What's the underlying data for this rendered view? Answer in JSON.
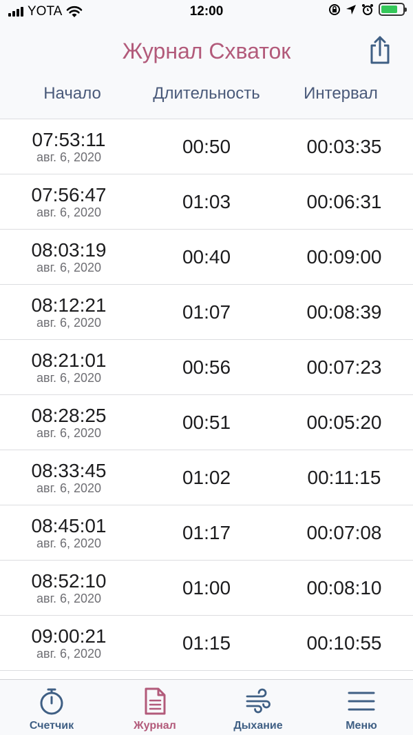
{
  "status_bar": {
    "carrier": "YOTA",
    "time": "12:00"
  },
  "header": {
    "title": "Журнал Схваток",
    "columns": [
      "Начало",
      "Длительность",
      "Интервал"
    ]
  },
  "rows": [
    {
      "start": "07:53:11",
      "date": "авг. 6, 2020",
      "duration": "00:50",
      "interval": "00:03:35"
    },
    {
      "start": "07:56:47",
      "date": "авг. 6, 2020",
      "duration": "01:03",
      "interval": "00:06:31"
    },
    {
      "start": "08:03:19",
      "date": "авг. 6, 2020",
      "duration": "00:40",
      "interval": "00:09:00"
    },
    {
      "start": "08:12:21",
      "date": "авг. 6, 2020",
      "duration": "01:07",
      "interval": "00:08:39"
    },
    {
      "start": "08:21:01",
      "date": "авг. 6, 2020",
      "duration": "00:56",
      "interval": "00:07:23"
    },
    {
      "start": "08:28:25",
      "date": "авг. 6, 2020",
      "duration": "00:51",
      "interval": "00:05:20"
    },
    {
      "start": "08:33:45",
      "date": "авг. 6, 2020",
      "duration": "01:02",
      "interval": "00:11:15"
    },
    {
      "start": "08:45:01",
      "date": "авг. 6, 2020",
      "duration": "01:17",
      "interval": "00:07:08"
    },
    {
      "start": "08:52:10",
      "date": "авг. 6, 2020",
      "duration": "01:00",
      "interval": "00:08:10"
    },
    {
      "start": "09:00:21",
      "date": "авг. 6, 2020",
      "duration": "01:15",
      "interval": "00:10:55"
    }
  ],
  "tab_bar": {
    "tabs": [
      {
        "label": "Счетчик",
        "icon": "stopwatch-icon",
        "active": false
      },
      {
        "label": "Журнал",
        "icon": "document-icon",
        "active": true
      },
      {
        "label": "Дыхание",
        "icon": "wind-icon",
        "active": false
      },
      {
        "label": "Меню",
        "icon": "menu-icon",
        "active": false
      }
    ]
  },
  "colors": {
    "accent": "#b25a7a",
    "tab_inactive": "#3f5f84",
    "header_text": "#4a5a7a",
    "battery": "#34c759"
  }
}
